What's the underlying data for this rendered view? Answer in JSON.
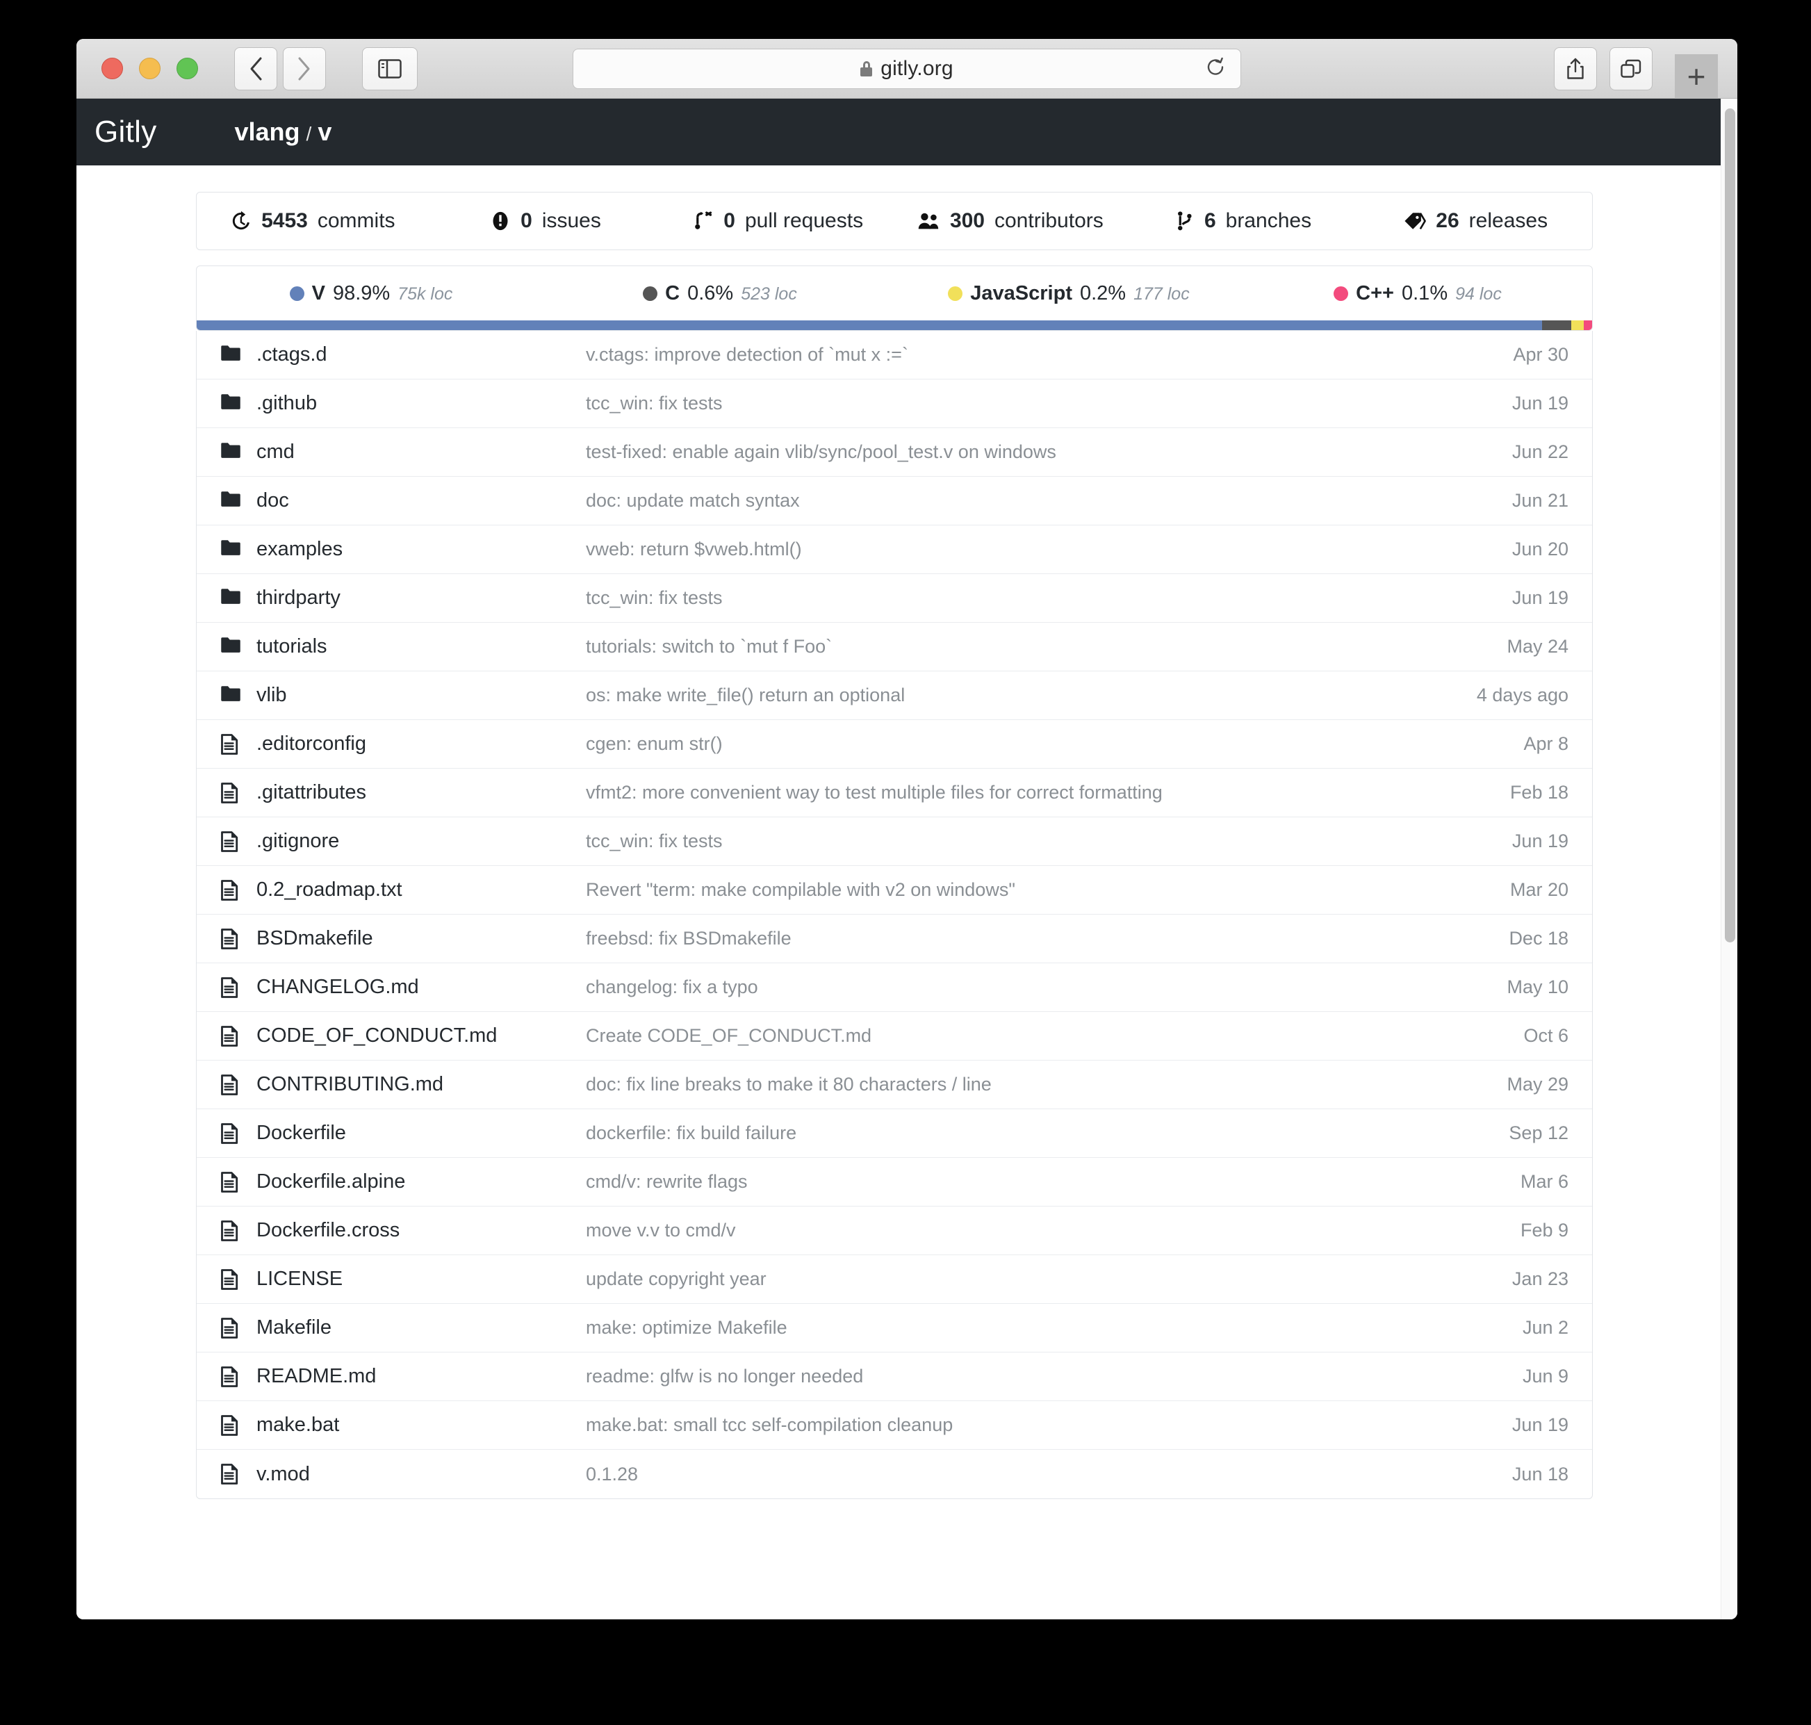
{
  "browser": {
    "url": "gitly.org",
    "lock_icon": "lock-icon",
    "back_icon": "chevron-left-icon",
    "forward_icon": "chevron-right-icon",
    "sidebar_icon": "sidebar-toggle-icon",
    "reload_icon": "reload-icon",
    "share_icon": "share-icon",
    "tabs_icon": "tabs-overview-icon",
    "newtab_label": "+"
  },
  "header": {
    "brand": "Gitly",
    "owner": "vlang",
    "separator": "/",
    "repo": "v"
  },
  "stats": [
    {
      "icon": "history-icon",
      "num": "5453",
      "label": "commits"
    },
    {
      "icon": "issue-icon",
      "num": "0",
      "label": "issues"
    },
    {
      "icon": "pull-request-icon",
      "num": "0",
      "label": "pull requests"
    },
    {
      "icon": "people-icon",
      "num": "300",
      "label": "contributors"
    },
    {
      "icon": "branch-icon",
      "num": "6",
      "label": "branches"
    },
    {
      "icon": "tag-icon",
      "num": "26",
      "label": "releases"
    }
  ],
  "languages": [
    {
      "name": "V",
      "pct": "98.9%",
      "loc": "75k loc",
      "color": "#6281b9"
    },
    {
      "name": "C",
      "pct": "0.6%",
      "loc": "523 loc",
      "color": "#555555"
    },
    {
      "name": "JavaScript",
      "pct": "0.2%",
      "loc": "177 loc",
      "color": "#f1e05a"
    },
    {
      "name": "C++",
      "pct": "0.1%",
      "loc": "94 loc",
      "color": "#f34b7d"
    }
  ],
  "language_bar": [
    {
      "name": "V",
      "width_pct": 96.4,
      "color": "#6281b9"
    },
    {
      "name": "C",
      "width_pct": 2.1,
      "color": "#555555"
    },
    {
      "name": "JavaScript",
      "width_pct": 0.9,
      "color": "#f1e05a"
    },
    {
      "name": "C++",
      "width_pct": 0.6,
      "color": "#f34b7d"
    }
  ],
  "files": [
    {
      "icon": "folder-icon",
      "name": ".ctags.d",
      "message": "v.ctags: improve detection of `mut x :=`",
      "date": "Apr 30"
    },
    {
      "icon": "folder-icon",
      "name": ".github",
      "message": "tcc_win: fix tests",
      "date": "Jun 19"
    },
    {
      "icon": "folder-icon",
      "name": "cmd",
      "message": "test-fixed: enable again vlib/sync/pool_test.v on windows",
      "date": "Jun 22"
    },
    {
      "icon": "folder-icon",
      "name": "doc",
      "message": "doc: update match syntax",
      "date": "Jun 21"
    },
    {
      "icon": "folder-icon",
      "name": "examples",
      "message": "vweb: return $vweb.html()",
      "date": "Jun 20"
    },
    {
      "icon": "folder-icon",
      "name": "thirdparty",
      "message": "tcc_win: fix tests",
      "date": "Jun 19"
    },
    {
      "icon": "folder-icon",
      "name": "tutorials",
      "message": "tutorials: switch to `mut f Foo`",
      "date": "May 24"
    },
    {
      "icon": "folder-icon",
      "name": "vlib",
      "message": "os: make write_file() return an optional",
      "date": "4 days ago"
    },
    {
      "icon": "file-icon",
      "name": ".editorconfig",
      "message": "cgen: enum str()",
      "date": "Apr 8"
    },
    {
      "icon": "file-icon",
      "name": ".gitattributes",
      "message": "vfmt2: more convenient way to test multiple files for correct formatting",
      "date": "Feb 18"
    },
    {
      "icon": "file-icon",
      "name": ".gitignore",
      "message": "tcc_win: fix tests",
      "date": "Jun 19"
    },
    {
      "icon": "file-icon",
      "name": "0.2_roadmap.txt",
      "message": "Revert \"term: make compilable with v2 on windows\"",
      "date": "Mar 20"
    },
    {
      "icon": "file-icon",
      "name": "BSDmakefile",
      "message": "freebsd: fix BSDmakefile",
      "date": "Dec 18"
    },
    {
      "icon": "file-icon",
      "name": "CHANGELOG.md",
      "message": "changelog: fix a typo",
      "date": "May 10"
    },
    {
      "icon": "file-icon",
      "name": "CODE_OF_CONDUCT.md",
      "message": "Create CODE_OF_CONDUCT.md",
      "date": "Oct 6"
    },
    {
      "icon": "file-icon",
      "name": "CONTRIBUTING.md",
      "message": "doc: fix line breaks to make it 80 characters / line",
      "date": "May 29"
    },
    {
      "icon": "file-icon",
      "name": "Dockerfile",
      "message": "dockerfile: fix build failure",
      "date": "Sep 12"
    },
    {
      "icon": "file-icon",
      "name": "Dockerfile.alpine",
      "message": "cmd/v: rewrite flags",
      "date": "Mar 6"
    },
    {
      "icon": "file-icon",
      "name": "Dockerfile.cross",
      "message": "move v.v to cmd/v",
      "date": "Feb 9"
    },
    {
      "icon": "file-icon",
      "name": "LICENSE",
      "message": "update copyright year",
      "date": "Jan 23"
    },
    {
      "icon": "file-icon",
      "name": "Makefile",
      "message": "make: optimize Makefile",
      "date": "Jun 2"
    },
    {
      "icon": "file-icon",
      "name": "README.md",
      "message": "readme: glfw is no longer needed",
      "date": "Jun 9"
    },
    {
      "icon": "file-icon",
      "name": "make.bat",
      "message": "make.bat: small tcc self-compilation cleanup",
      "date": "Jun 19"
    },
    {
      "icon": "file-icon",
      "name": "v.mod",
      "message": "0.1.28",
      "date": "Jun 18"
    }
  ]
}
